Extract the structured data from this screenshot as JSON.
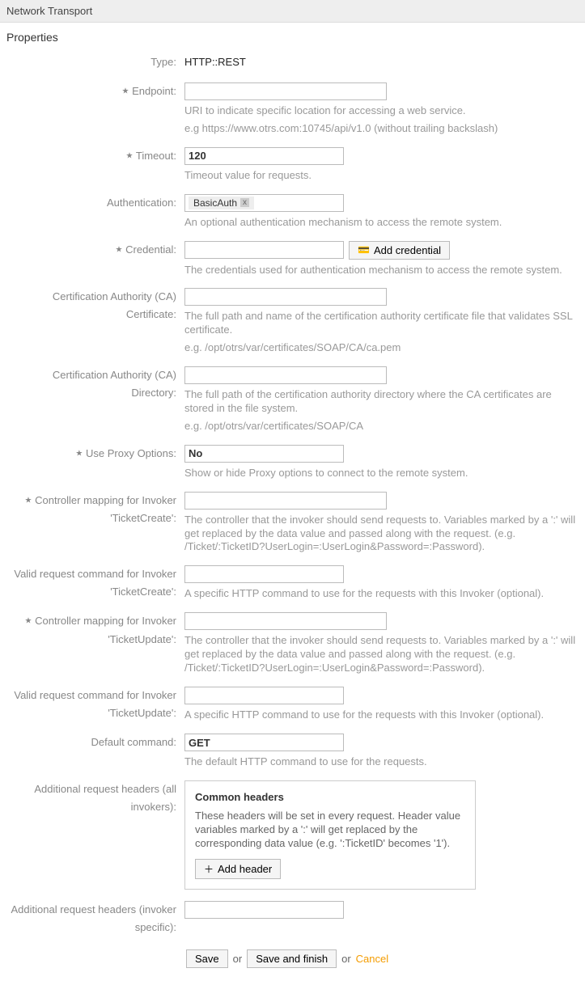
{
  "header": {
    "title": "Network Transport"
  },
  "section": {
    "title": "Properties"
  },
  "fields": {
    "type": {
      "label": "Type:",
      "value": "HTTP::REST"
    },
    "endpoint": {
      "label": "Endpoint:",
      "help1": "URI to indicate specific location for accessing a web service.",
      "help2": "e.g https://www.otrs.com:10745/api/v1.0 (without trailing backslash)"
    },
    "timeout": {
      "label": "Timeout:",
      "value": "120",
      "help": "Timeout value for requests."
    },
    "auth": {
      "label": "Authentication:",
      "tag": "BasicAuth",
      "help": "An optional authentication mechanism to access the remote system."
    },
    "credential": {
      "label": "Credential:",
      "button": "Add credential",
      "help": "The credentials used for authentication mechanism to access the remote system."
    },
    "ca_cert": {
      "label": "Certification Authority (CA) Certificate:",
      "help1": "The full path and name of the certification authority certificate file that validates SSL certificate.",
      "help2": "e.g. /opt/otrs/var/certificates/SOAP/CA/ca.pem"
    },
    "ca_dir": {
      "label": "Certification Authority (CA) Directory:",
      "help1": "The full path of the certification authority directory where the CA certificates are stored in the file system.",
      "help2": "e.g. /opt/otrs/var/certificates/SOAP/CA"
    },
    "proxy": {
      "label": "Use Proxy Options:",
      "value": "No",
      "help": "Show or hide Proxy options to connect to the remote system."
    },
    "controller_ticketcreate": {
      "label": "Controller mapping for Invoker 'TicketCreate':",
      "help": "The controller that the invoker should send requests to. Variables marked by a ':' will get replaced by the data value and passed along with the request. (e.g. /Ticket/:TicketID?UserLogin=:UserLogin&Password=:Password)."
    },
    "valid_cmd_ticketcreate": {
      "label": "Valid request command for Invoker 'TicketCreate':",
      "help": "A specific HTTP command to use for the requests with this Invoker (optional)."
    },
    "controller_ticketupdate": {
      "label": "Controller mapping for Invoker 'TicketUpdate':",
      "help": "The controller that the invoker should send requests to. Variables marked by a ':' will get replaced by the data value and passed along with the request. (e.g. /Ticket/:TicketID?UserLogin=:UserLogin&Password=:Password)."
    },
    "valid_cmd_ticketupdate": {
      "label": "Valid request command for Invoker 'TicketUpdate':",
      "help": "A specific HTTP command to use for the requests with this Invoker (optional)."
    },
    "default_cmd": {
      "label": "Default command:",
      "value": "GET",
      "help": "The default HTTP command to use for the requests."
    },
    "headers_all": {
      "label": "Additional request headers (all invokers):",
      "title": "Common headers",
      "desc": "These headers will be set in every request. Header value variables marked by a ':' will get replaced by the corresponding data value (e.g. ':TicketID' becomes '1').",
      "button": "Add header"
    },
    "headers_specific": {
      "label": "Additional request headers (invoker specific):"
    }
  },
  "actions": {
    "save": "Save",
    "save_finish": "Save and finish",
    "or": "or",
    "cancel": "Cancel"
  }
}
